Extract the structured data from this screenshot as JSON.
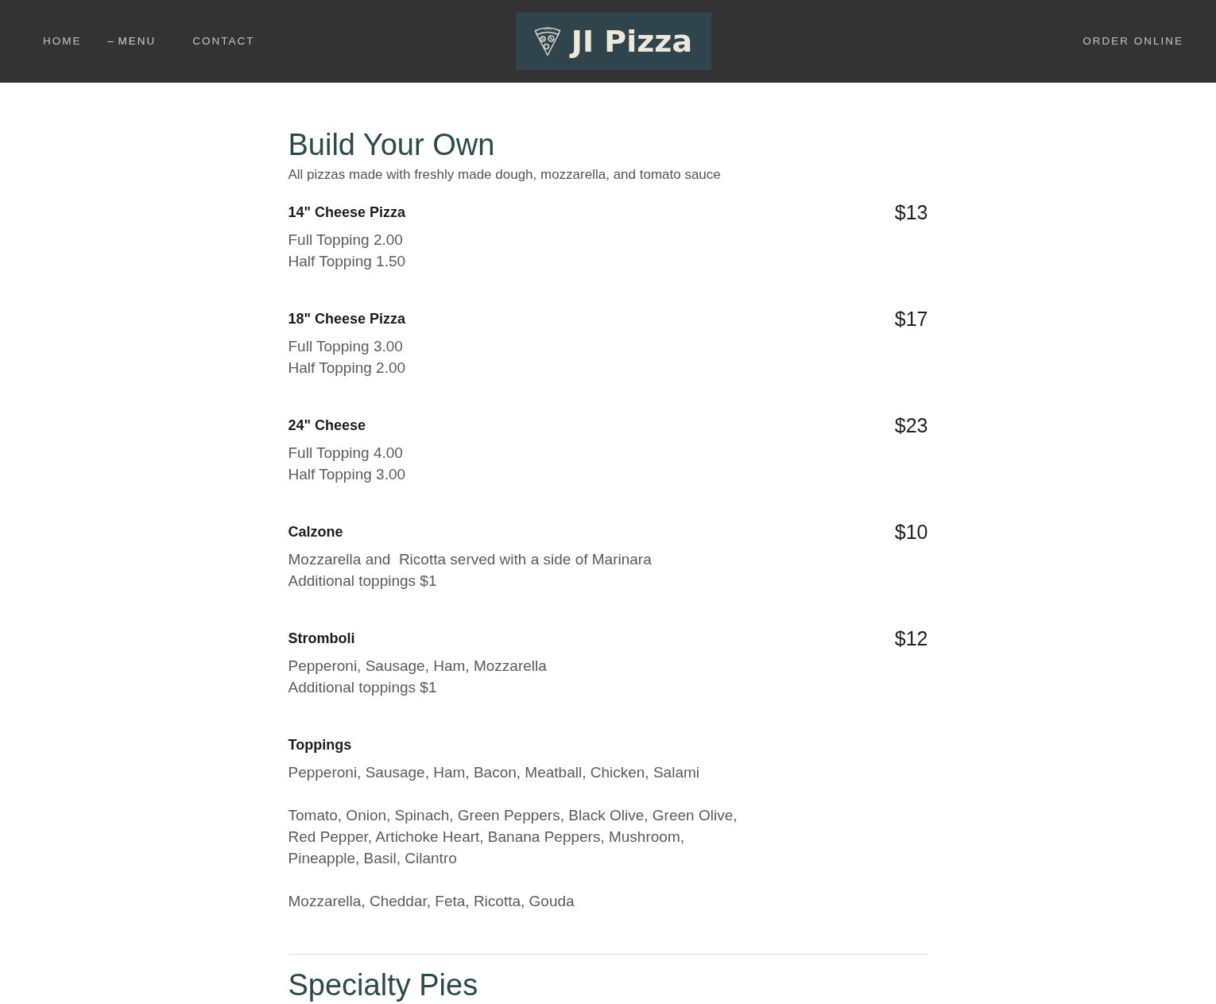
{
  "header": {
    "nav": [
      {
        "label": "HOME",
        "selected": false
      },
      {
        "label": "MENU",
        "selected": true
      },
      {
        "label": "CONTACT",
        "selected": false
      }
    ],
    "logo": {
      "text": "JI Pizza"
    },
    "order_link": "ORDER ONLINE"
  },
  "sections": [
    {
      "title": "Build Your Own",
      "subtitle": "All pizzas made with freshly made dough, mozzarella, and tomato sauce",
      "items": [
        {
          "name": "14\" Cheese Pizza",
          "price": "$13",
          "description": [
            [
              "Full Topping 2.00",
              "Half Topping 1.50"
            ]
          ]
        },
        {
          "name": "18\" Cheese Pizza",
          "price": "$17",
          "description": [
            [
              "Full Topping 3.00",
              "Half Topping 2.00"
            ]
          ]
        },
        {
          "name": "24\" Cheese",
          "price": "$23",
          "description": [
            [
              "Full Topping 4.00",
              "Half Topping 3.00"
            ]
          ]
        },
        {
          "name": "Calzone",
          "price": "$10",
          "description": [
            [
              "Mozzarella and  Ricotta served with a side of Marinara",
              "Additional toppings $1"
            ]
          ]
        },
        {
          "name": "Stromboli",
          "price": "$12",
          "description": [
            [
              "Pepperoni, Sausage, Ham, Mozzarella",
              "Additional toppings $1"
            ]
          ]
        },
        {
          "name": "Toppings",
          "description": [
            [
              "Pepperoni, Sausage, Ham, Bacon, Meatball, Chicken, Salami"
            ],
            [
              "Tomato, Onion, Spinach, Green Peppers, Black Olive, Green Olive,",
              "Red Pepper, Artichoke Heart, Banana Peppers, Mushroom,",
              "Pineapple, Basil, Cilantro"
            ],
            [
              "Mozzarella, Cheddar, Feta, Ricotta, Gouda"
            ]
          ]
        }
      ]
    },
    {
      "title": "Specialty Pies"
    }
  ]
}
